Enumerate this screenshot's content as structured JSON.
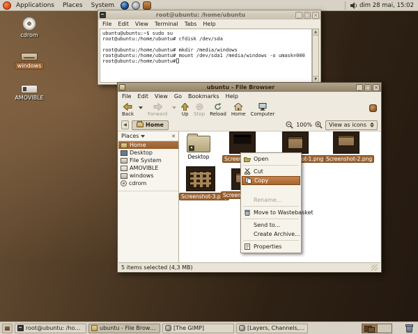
{
  "top_panel": {
    "menus": [
      "Applications",
      "Places",
      "System"
    ],
    "clock": "dim 28 mai, 15:02"
  },
  "desktop_icons": [
    {
      "label": "cdrom",
      "selected": false
    },
    {
      "label": "windows",
      "selected": true
    },
    {
      "label": "AMOVIBLE",
      "selected": false
    }
  ],
  "terminal_window": {
    "title": "root@ubuntu: /home/ubuntu",
    "menu": [
      "File",
      "Edit",
      "View",
      "Terminal",
      "Tabs",
      "Help"
    ],
    "lines": [
      "ubuntu@ubuntu:~$ sudo su",
      "root@ubuntu:/home/ubuntu# cfdisk /dev/sda",
      "",
      "root@ubuntu:/home/ubuntu# mkdir /media/windows",
      "root@ubuntu:/home/ubuntu# mount /dev/sda1 /media/windows -o umask=000",
      "root@ubuntu:/home/ubuntu#"
    ]
  },
  "file_browser": {
    "title": "ubuntu - File Browser",
    "menu": [
      "File",
      "Edit",
      "View",
      "Go",
      "Bookmarks",
      "Help"
    ],
    "toolbar": {
      "back": "Back",
      "forward": "Forward",
      "up": "Up",
      "stop": "Stop",
      "reload": "Reload",
      "home": "Home",
      "computer": "Computer"
    },
    "location": {
      "path_button": "Home",
      "zoom_level": "100%",
      "view_mode": "View as icons"
    },
    "sidebar": {
      "header": "Places",
      "items": [
        {
          "label": "Home",
          "selected": true
        },
        {
          "label": "Desktop",
          "selected": false
        },
        {
          "label": "File System",
          "selected": false
        },
        {
          "label": "AMOVIBLE",
          "selected": false
        },
        {
          "label": "windows",
          "selected": false
        },
        {
          "label": "cdrom",
          "selected": false
        }
      ]
    },
    "files": [
      {
        "label": "Desktop",
        "type": "folder",
        "selected": false
      },
      {
        "label": "Screenshot.png",
        "type": "image",
        "selected": true
      },
      {
        "label": "Screenshot-1.png",
        "type": "image",
        "selected": true
      },
      {
        "label": "Screenshot-2.png",
        "type": "image",
        "selected": true
      },
      {
        "label": "Screenshot-3.png",
        "type": "image",
        "selected": true
      },
      {
        "label": "Screenshot-4.png",
        "type": "image",
        "selected": true
      }
    ],
    "status": "5 items selected (4,3 MB)"
  },
  "context_menu": {
    "items": [
      {
        "label": "Open",
        "icon": "folder-open-icon",
        "highlighted": false,
        "disabled": false
      },
      {
        "label": "Cut",
        "icon": "cut-icon",
        "highlighted": false,
        "disabled": false
      },
      {
        "label": "Copy",
        "icon": "copy-icon",
        "highlighted": true,
        "disabled": false
      },
      {
        "label": "Rename...",
        "icon": "",
        "highlighted": false,
        "disabled": true
      },
      {
        "label": "Move to Wastebasket",
        "icon": "trash-icon",
        "highlighted": false,
        "disabled": false
      },
      {
        "label": "Send to...",
        "icon": "",
        "highlighted": false,
        "disabled": false
      },
      {
        "label": "Create Archive...",
        "icon": "",
        "highlighted": false,
        "disabled": false
      },
      {
        "label": "Properties",
        "icon": "properties-icon",
        "highlighted": false,
        "disabled": false
      }
    ]
  },
  "taskbar": {
    "windows": [
      {
        "label": "root@ubuntu: /home/ubuntu",
        "active": false
      },
      {
        "label": "ubuntu - File Browser",
        "active": true
      },
      {
        "label": "[The GIMP]",
        "active": false
      },
      {
        "label": "[Layers, Channels, Paths, U...",
        "active": false
      }
    ]
  },
  "colors": {
    "selection": "#9c6433",
    "menu_highlight": "#b06f36",
    "panel": "#d8d2c6",
    "desktop_dark": "#231810",
    "desktop_light": "#6e5539"
  }
}
